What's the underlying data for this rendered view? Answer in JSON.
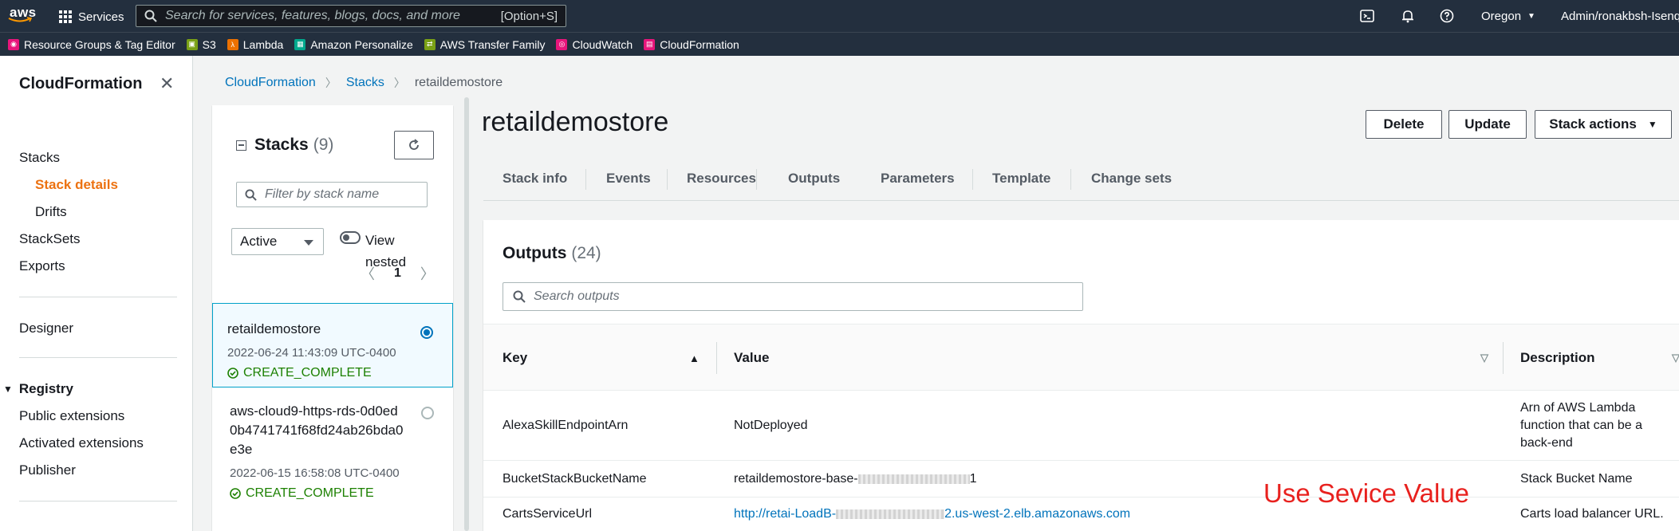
{
  "topbar": {
    "logo_text": "aws",
    "services_label": "Services",
    "search_placeholder": "Search for services, features, blogs, docs, and more",
    "search_shortcut": "[Option+S]",
    "region": "Oregon",
    "account": "Admin/ronakbsh-Isenq"
  },
  "favorites": [
    {
      "label": "Resource Groups & Tag Editor",
      "color": "#e7157b",
      "icon": "resource-groups-icon"
    },
    {
      "label": "S3",
      "color": "#7aa116",
      "icon": "s3-icon"
    },
    {
      "label": "Lambda",
      "color": "#ed7100",
      "icon": "lambda-icon"
    },
    {
      "label": "Amazon Personalize",
      "color": "#01a88d",
      "icon": "personalize-icon"
    },
    {
      "label": "AWS Transfer Family",
      "color": "#7aa116",
      "icon": "transfer-family-icon"
    },
    {
      "label": "CloudWatch",
      "color": "#e7157b",
      "icon": "cloudwatch-icon"
    },
    {
      "label": "CloudFormation",
      "color": "#e7157b",
      "icon": "cloudformation-icon"
    }
  ],
  "sidenav": {
    "title": "CloudFormation",
    "items": {
      "stacks": "Stacks",
      "stack_details": "Stack details",
      "drifts": "Drifts",
      "stacksets": "StackSets",
      "exports": "Exports",
      "designer": "Designer",
      "registry": "Registry",
      "public_extensions": "Public extensions",
      "activated_extensions": "Activated extensions",
      "publisher": "Publisher"
    }
  },
  "breadcrumb": {
    "root": "CloudFormation",
    "stacks": "Stacks",
    "current": "retaildemostore"
  },
  "stacks_panel": {
    "title": "Stacks",
    "count": "(9)",
    "filter_placeholder": "Filter by stack name",
    "status_filter": "Active",
    "view_nested_label": "View nested",
    "page": "1",
    "stacks": [
      {
        "name": "retaildemostore",
        "date": "2022-06-24 11:43:09 UTC-0400",
        "status": "CREATE_COMPLETE"
      },
      {
        "name": "aws-cloud9-https-rds-0d0ed0b4741741f68fd24ab26bda0e3e",
        "date": "2022-06-15 16:58:08 UTC-0400",
        "status": "CREATE_COMPLETE"
      }
    ]
  },
  "stack": {
    "title": "retaildemostore",
    "delete_label": "Delete",
    "update_label": "Update",
    "actions_label": "Stack actions"
  },
  "tabs": [
    "Stack info",
    "Events",
    "Resources",
    "Outputs",
    "Parameters",
    "Template",
    "Change sets"
  ],
  "outputs": {
    "title": "Outputs",
    "count": "(24)",
    "search_placeholder": "Search outputs",
    "columns": {
      "key": "Key",
      "value": "Value",
      "description": "Description"
    },
    "rows": [
      {
        "key": "AlexaSkillEndpointArn",
        "value": "NotDeployed",
        "description": "Arn of AWS Lambda function that can be a back-end"
      },
      {
        "key": "BucketStackBucketName",
        "value_prefix": "retaildemostore-base-",
        "value_suffix": "1",
        "description": "Stack Bucket Name"
      },
      {
        "key": "CartsServiceUrl",
        "value_prefix": "http://retai-LoadB-",
        "value_suffix": "2.us-west-2.elb.amazonaws.com",
        "description": "Carts load balancer URL."
      }
    ]
  },
  "annotation": "Use Sevice Value"
}
